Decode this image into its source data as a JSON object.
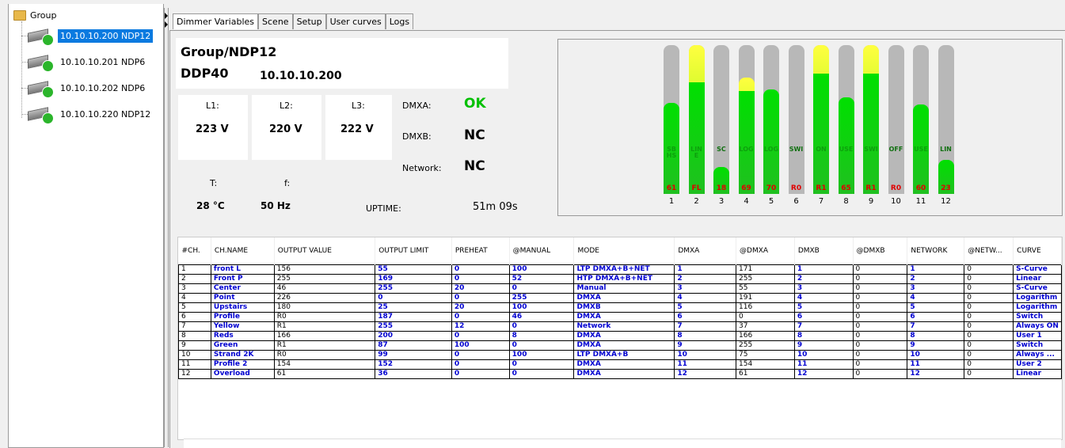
{
  "tree": {
    "root_label": "Group",
    "nodes": [
      {
        "label": "10.10.10.200 NDP12",
        "selected": true
      },
      {
        "label": "10.10.10.201 NDP6",
        "selected": false
      },
      {
        "label": "10.10.10.202 NDP6",
        "selected": false
      },
      {
        "label": "10.10.10.220 NDP12",
        "selected": false
      }
    ]
  },
  "tabs": [
    "Dimmer Variables",
    "Scene",
    "Setup",
    "User curves",
    "Logs"
  ],
  "info": {
    "path": "Group/NDP12",
    "model": "DDP40",
    "ip": "10.10.10.200",
    "l1_label": "L1:",
    "l1_value": "223 V",
    "l2_label": "L2:",
    "l2_value": "220 V",
    "l3_label": "L3:",
    "l3_value": "222 V",
    "t_label": "T:",
    "t_value": "28 °C",
    "f_label": "f:",
    "f_value": "50 Hz",
    "uptime_label": "UPTIME:",
    "uptime_value": "51m 09s",
    "dmxa_label": "DMXA:",
    "dmxa_value": "OK",
    "dmxb_label": "DMXB:",
    "dmxb_value": "NC",
    "network_label": "Network:",
    "network_value": "NC",
    "ok_color": "#00c000"
  },
  "channel_bars": [
    {
      "num": "1",
      "level": 0.61,
      "peak": null,
      "label": "61",
      "name": "SB HS"
    },
    {
      "num": "2",
      "level": 0.75,
      "peak": 1.0,
      "label": "FL",
      "name": "LINE"
    },
    {
      "num": "3",
      "level": 0.18,
      "peak": null,
      "label": "18",
      "name": "SC"
    },
    {
      "num": "4",
      "level": 0.69,
      "peak": 0.78,
      "label": "69",
      "name": "LOG"
    },
    {
      "num": "5",
      "level": 0.7,
      "peak": null,
      "label": "70",
      "name": "LOG"
    },
    {
      "num": "6",
      "level": 0.0,
      "peak": null,
      "label": "R0",
      "name": "SWI"
    },
    {
      "num": "7",
      "level": 0.81,
      "peak": 1.0,
      "label": "R1",
      "name": "ON"
    },
    {
      "num": "8",
      "level": 0.65,
      "peak": null,
      "label": "65",
      "name": "USE"
    },
    {
      "num": "9",
      "level": 0.81,
      "peak": 1.0,
      "label": "R1",
      "name": "SWI"
    },
    {
      "num": "10",
      "level": 0.0,
      "peak": null,
      "label": "R0",
      "name": "OFF"
    },
    {
      "num": "11",
      "level": 0.6,
      "peak": null,
      "label": "60",
      "name": "USE"
    },
    {
      "num": "12",
      "level": 0.23,
      "peak": null,
      "label": "23",
      "name": "LIN"
    }
  ],
  "table": {
    "columns": [
      "#CH.",
      "CH.NAME",
      "OUTPUT VALUE",
      "OUTPUT LIMIT",
      "PREHEAT",
      "@MANUAL",
      "MODE",
      "DMXA",
      "@DMXA",
      "DMXB",
      "@DMXB",
      "NETWORK",
      "@NETW...",
      "CURVE"
    ],
    "rows": [
      [
        "1",
        "front L",
        "156",
        "55",
        "0",
        "100",
        "LTP DMXA+B+NET",
        "1",
        "171",
        "1",
        "0",
        "1",
        "0",
        "S-Curve"
      ],
      [
        "2",
        "Front P",
        "255",
        "169",
        "0",
        "52",
        "HTP DMXA+B+NET",
        "2",
        "255",
        "2",
        "0",
        "2",
        "0",
        "Linear"
      ],
      [
        "3",
        "Center",
        "46",
        "255",
        "20",
        "0",
        "Manual",
        "3",
        "55",
        "3",
        "0",
        "3",
        "0",
        "S-Curve"
      ],
      [
        "4",
        "Point",
        "226",
        "0",
        "0",
        "255",
        "DMXA",
        "4",
        "191",
        "4",
        "0",
        "4",
        "0",
        "Logarithm"
      ],
      [
        "5",
        "Upstairs",
        "180",
        "25",
        "20",
        "100",
        "DMXB",
        "5",
        "116",
        "5",
        "0",
        "5",
        "0",
        "Logarithm"
      ],
      [
        "6",
        "Profile",
        "R0",
        "187",
        "0",
        "46",
        "DMXA",
        "6",
        "0",
        "6",
        "0",
        "6",
        "0",
        "Switch"
      ],
      [
        "7",
        "Yellow",
        "R1",
        "255",
        "12",
        "0",
        "Network",
        "7",
        "37",
        "7",
        "0",
        "7",
        "0",
        "Always ON"
      ],
      [
        "8",
        "Reds",
        "166",
        "200",
        "0",
        "8",
        "DMXA",
        "8",
        "166",
        "8",
        "0",
        "8",
        "0",
        "User 1"
      ],
      [
        "9",
        "Green",
        "R1",
        "87",
        "100",
        "0",
        "DMXA",
        "9",
        "255",
        "9",
        "0",
        "9",
        "0",
        "Switch"
      ],
      [
        "10",
        "Strand 2K",
        "R0",
        "99",
        "0",
        "100",
        "LTP DMXA+B",
        "10",
        "75",
        "10",
        "0",
        "10",
        "0",
        "Always ..."
      ],
      [
        "11",
        "Profile 2",
        "154",
        "152",
        "0",
        "0",
        "DMXA",
        "11",
        "154",
        "11",
        "0",
        "11",
        "0",
        "User 2"
      ],
      [
        "12",
        "Overload",
        "61",
        "36",
        "0",
        "0",
        "DMXA",
        "12",
        "61",
        "12",
        "0",
        "12",
        "0",
        "Linear"
      ]
    ]
  }
}
